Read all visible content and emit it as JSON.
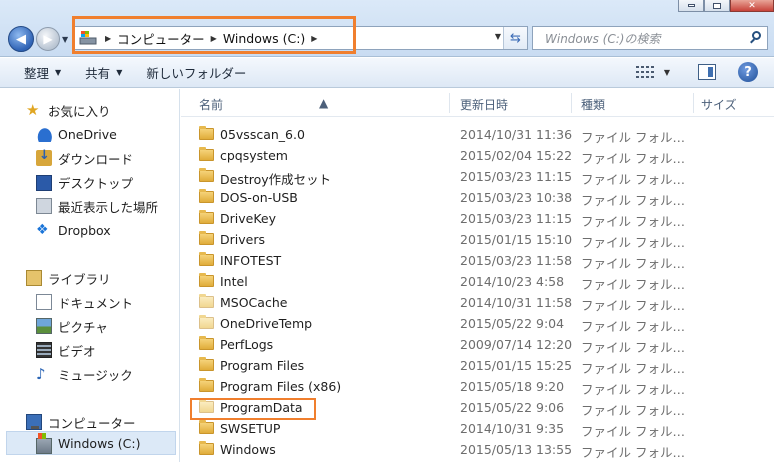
{
  "window": {
    "controls": [
      "minimize",
      "maximize",
      "close"
    ]
  },
  "address": {
    "crumbs": [
      "コンピューター",
      "Windows (C:)"
    ]
  },
  "search": {
    "placeholder": "Windows (C:)の検索"
  },
  "toolbar": {
    "organize": "整理",
    "share": "共有",
    "new_folder": "新しいフォルダー"
  },
  "navpane": {
    "favorites": "お気に入り",
    "favorite_items": [
      "OneDrive",
      "ダウンロード",
      "デスクトップ",
      "最近表示した場所",
      "Dropbox"
    ],
    "libraries": "ライブラリ",
    "library_items": [
      "ドキュメント",
      "ピクチャ",
      "ビデオ",
      "ミュージック"
    ],
    "computer": "コンピューター",
    "computer_items": [
      "Windows (C:)"
    ]
  },
  "columns": {
    "name": "名前",
    "date": "更新日時",
    "type": "種類",
    "size": "サイズ"
  },
  "files": [
    {
      "name": "05vsscan_6.0",
      "date": "2014/10/31 11:36",
      "type": "ファイル フォル…",
      "pale": false
    },
    {
      "name": "cpqsystem",
      "date": "2015/02/04 15:22",
      "type": "ファイル フォル…",
      "pale": false
    },
    {
      "name": "Destroy作成セット",
      "date": "2015/03/23 11:15",
      "type": "ファイル フォル…",
      "pale": false
    },
    {
      "name": "DOS-on-USB",
      "date": "2015/03/23 10:38",
      "type": "ファイル フォル…",
      "pale": false
    },
    {
      "name": "DriveKey",
      "date": "2015/03/23 11:15",
      "type": "ファイル フォル…",
      "pale": false
    },
    {
      "name": "Drivers",
      "date": "2015/01/15 15:10",
      "type": "ファイル フォル…",
      "pale": false
    },
    {
      "name": "INFOTEST",
      "date": "2015/03/23 11:58",
      "type": "ファイル フォル…",
      "pale": false
    },
    {
      "name": "Intel",
      "date": "2014/10/23 4:58",
      "type": "ファイル フォル…",
      "pale": false
    },
    {
      "name": "MSOCache",
      "date": "2014/10/31 11:58",
      "type": "ファイル フォル…",
      "pale": true
    },
    {
      "name": "OneDriveTemp",
      "date": "2015/05/22 9:04",
      "type": "ファイル フォル…",
      "pale": true
    },
    {
      "name": "PerfLogs",
      "date": "2009/07/14 12:20",
      "type": "ファイル フォル…",
      "pale": false
    },
    {
      "name": "Program Files",
      "date": "2015/01/15 15:25",
      "type": "ファイル フォル…",
      "pale": false
    },
    {
      "name": "Program Files (x86)",
      "date": "2015/05/18 9:20",
      "type": "ファイル フォル…",
      "pale": false
    },
    {
      "name": "ProgramData",
      "date": "2015/05/22 9:06",
      "type": "ファイル フォル…",
      "pale": true
    },
    {
      "name": "SWSETUP",
      "date": "2014/10/31 9:35",
      "type": "ファイル フォル…",
      "pale": false
    },
    {
      "name": "Windows",
      "date": "2015/05/13 13:55",
      "type": "ファイル フォル…",
      "pale": false
    }
  ],
  "colors": {
    "highlight": "#f07f2e",
    "selection": "#dce9f7"
  }
}
